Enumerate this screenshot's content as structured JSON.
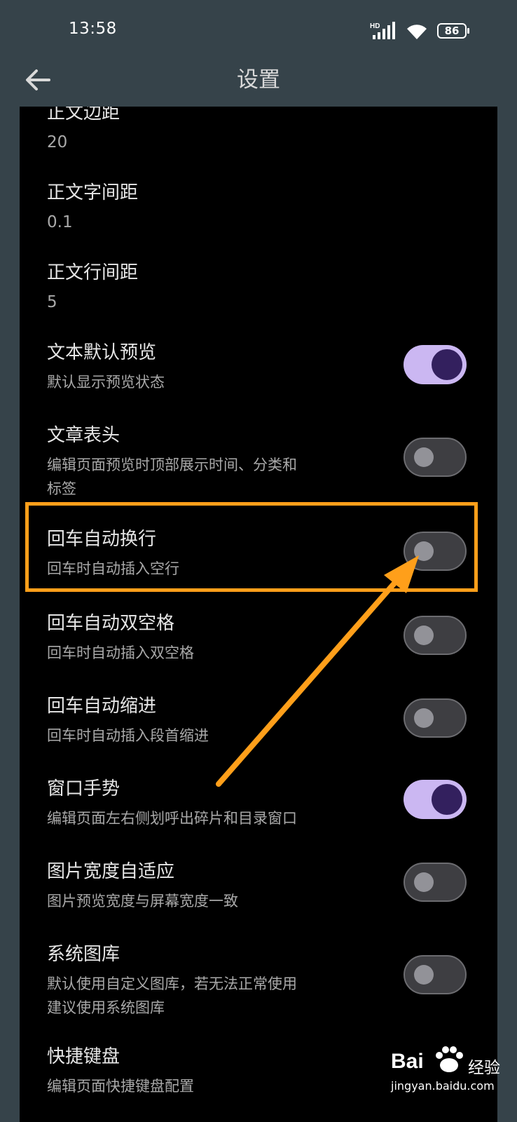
{
  "status_bar": {
    "time": "13:58",
    "network_badge": "HD",
    "battery_level": "86"
  },
  "app_bar": {
    "title": "设置",
    "back_icon": "arrow-left-icon"
  },
  "settings": [
    {
      "title": "正文边距",
      "value": "20"
    },
    {
      "title": "正文字间距",
      "value": "0.1"
    },
    {
      "title": "正文行间距",
      "value": "5"
    },
    {
      "title": "文本默认预览",
      "subtitle": "默认显示预览状态",
      "enabled": true
    },
    {
      "title": "文章表头",
      "subtitle_line1": "编辑页面预览时顶部展示时间、分类和",
      "subtitle_line2": "标签",
      "enabled": false
    },
    {
      "title": "回车自动换行",
      "subtitle": "回车时自动插入空行",
      "enabled": false
    },
    {
      "title": "回车自动双空格",
      "subtitle": "回车时自动插入双空格",
      "enabled": false
    },
    {
      "title": "回车自动缩进",
      "subtitle": "回车时自动插入段首缩进",
      "enabled": false
    },
    {
      "title": "窗口手势",
      "subtitle": "编辑页面左右侧划呼出碎片和目录窗口",
      "enabled": true
    },
    {
      "title": "图片宽度自适应",
      "subtitle": "图片预览宽度与屏幕宽度一致",
      "enabled": false
    },
    {
      "title": "系统图库",
      "subtitle_line1": "默认使用自定义图库，若无法正常使用",
      "subtitle_line2": "建议使用系统图库",
      "enabled": false
    },
    {
      "title": "快捷键盘",
      "subtitle": "编辑页面快捷键盘配置"
    }
  ],
  "watermark": {
    "logo_left": "Bai",
    "logo_right": "经验",
    "url": "jingyan.baidu.com"
  },
  "colors": {
    "toggle_on_track": "#cbb7f2",
    "toggle_on_knob": "#33205e",
    "highlight": "#ff9f1a",
    "header_bg": "#36434a"
  }
}
